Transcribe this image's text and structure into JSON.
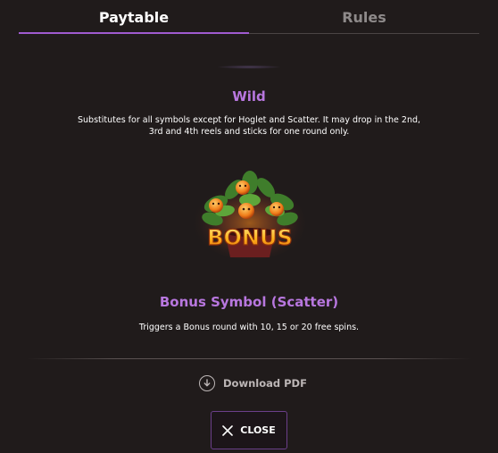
{
  "tabs": [
    {
      "label": "Paytable",
      "active": true
    },
    {
      "label": "Rules",
      "active": false
    }
  ],
  "wild": {
    "title": "Wild",
    "description": "Substitutes for all symbols except for Hoglet and Scatter. It may drop in the 2nd, 3rd and 4th reels and sticks for one round only."
  },
  "bonus": {
    "symbol_text": "BONUS",
    "title": "Bonus Symbol (Scatter)",
    "description": "Triggers a Bonus round with 10, 15 or 20 free spins."
  },
  "download": {
    "label": "Download PDF",
    "icon": "download-circle-icon"
  },
  "close": {
    "label": "CLOSE",
    "icon": "close-icon"
  },
  "colors": {
    "accent": "#b877df",
    "background": "#201b1b",
    "tab_active_bar": "#a05bd0",
    "muted_text": "#bdb7b7"
  }
}
